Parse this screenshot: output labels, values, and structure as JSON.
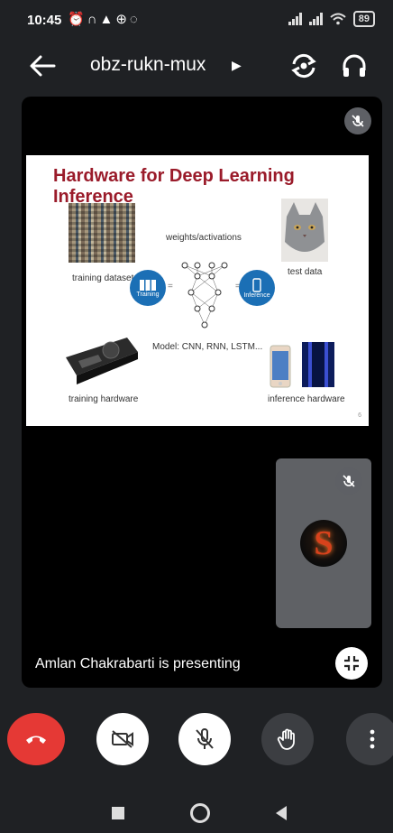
{
  "status_bar": {
    "time": "10:45",
    "icons": [
      "alarm-icon",
      "headphones-icon",
      "alert-icon",
      "globe-icon",
      "whatsapp-icon"
    ],
    "battery": "89"
  },
  "header": {
    "meeting_code": "obz-rukn-mux"
  },
  "slide": {
    "title": "Hardware for Deep Learning Inference",
    "labels": {
      "training_dataset": "training dataset",
      "weights": "weights/activations",
      "test_data": "test data",
      "training": "Training",
      "inference": "Inference",
      "model": "Model: CNN, RNN, LSTM...",
      "training_hardware": "training hardware",
      "inference_hardware": "inference hardware",
      "page_number": "6"
    }
  },
  "stage": {
    "presenting_text": "Amlan Chakrabarti is presenting",
    "self_avatar_letter": "S"
  },
  "colors": {
    "background": "#1f2124",
    "end_call": "#e53935",
    "slide_title": "#9a1b2a"
  }
}
